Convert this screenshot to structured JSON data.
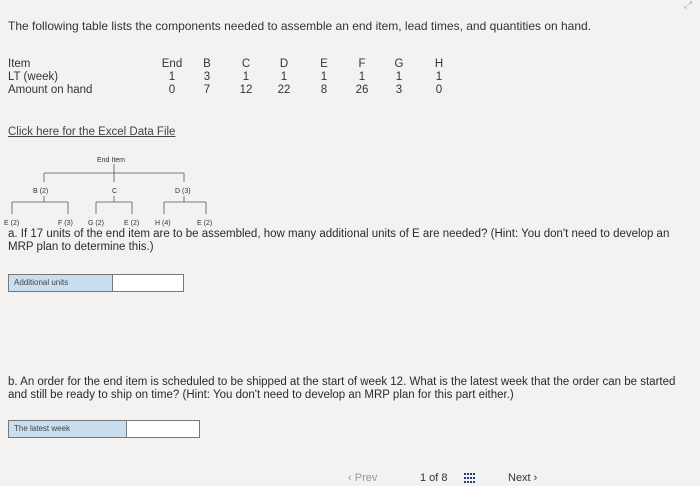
{
  "intro_text": "The following table lists the components needed to assemble an end item, lead times, and quantities on hand.",
  "table": {
    "columns": [
      "End",
      "B",
      "C",
      "D",
      "E",
      "F",
      "G",
      "H"
    ],
    "rows": [
      {
        "label": "Item",
        "values": [
          "End",
          "B",
          "C",
          "D",
          "E",
          "F",
          "G",
          "H"
        ]
      },
      {
        "label": "LT (week)",
        "values": [
          "1",
          "3",
          "1",
          "1",
          "1",
          "1",
          "1",
          "1"
        ]
      },
      {
        "label": "Amount on hand",
        "values": [
          "0",
          "7",
          "12",
          "22",
          "8",
          "26",
          "3",
          "0"
        ]
      }
    ]
  },
  "excel_link": "Click here for the Excel Data File",
  "tree": {
    "root": "End Item",
    "level1": [
      "B (2)",
      "C",
      "D (3)"
    ],
    "level2": [
      "E (2)",
      "F (3)",
      "G (2)",
      "E (2)",
      "H (4)",
      "E (2)"
    ]
  },
  "question_a": "a. If 17 units of the end item are to be assembled, how many additional units of E are needed? (Hint: You don't need to develop an MRP plan to determine this.)",
  "field_a_label": "Additional units",
  "question_b": "b. An order for the end item is scheduled to be shipped at the start of week 12. What is the latest week that the order can be started and still be ready to ship on time? (Hint: You don't need to develop an MRP plan for this part either.)",
  "field_b_label": "The latest week",
  "footer": {
    "prev": "Prev",
    "page": "1 of 8",
    "next": "Next"
  }
}
